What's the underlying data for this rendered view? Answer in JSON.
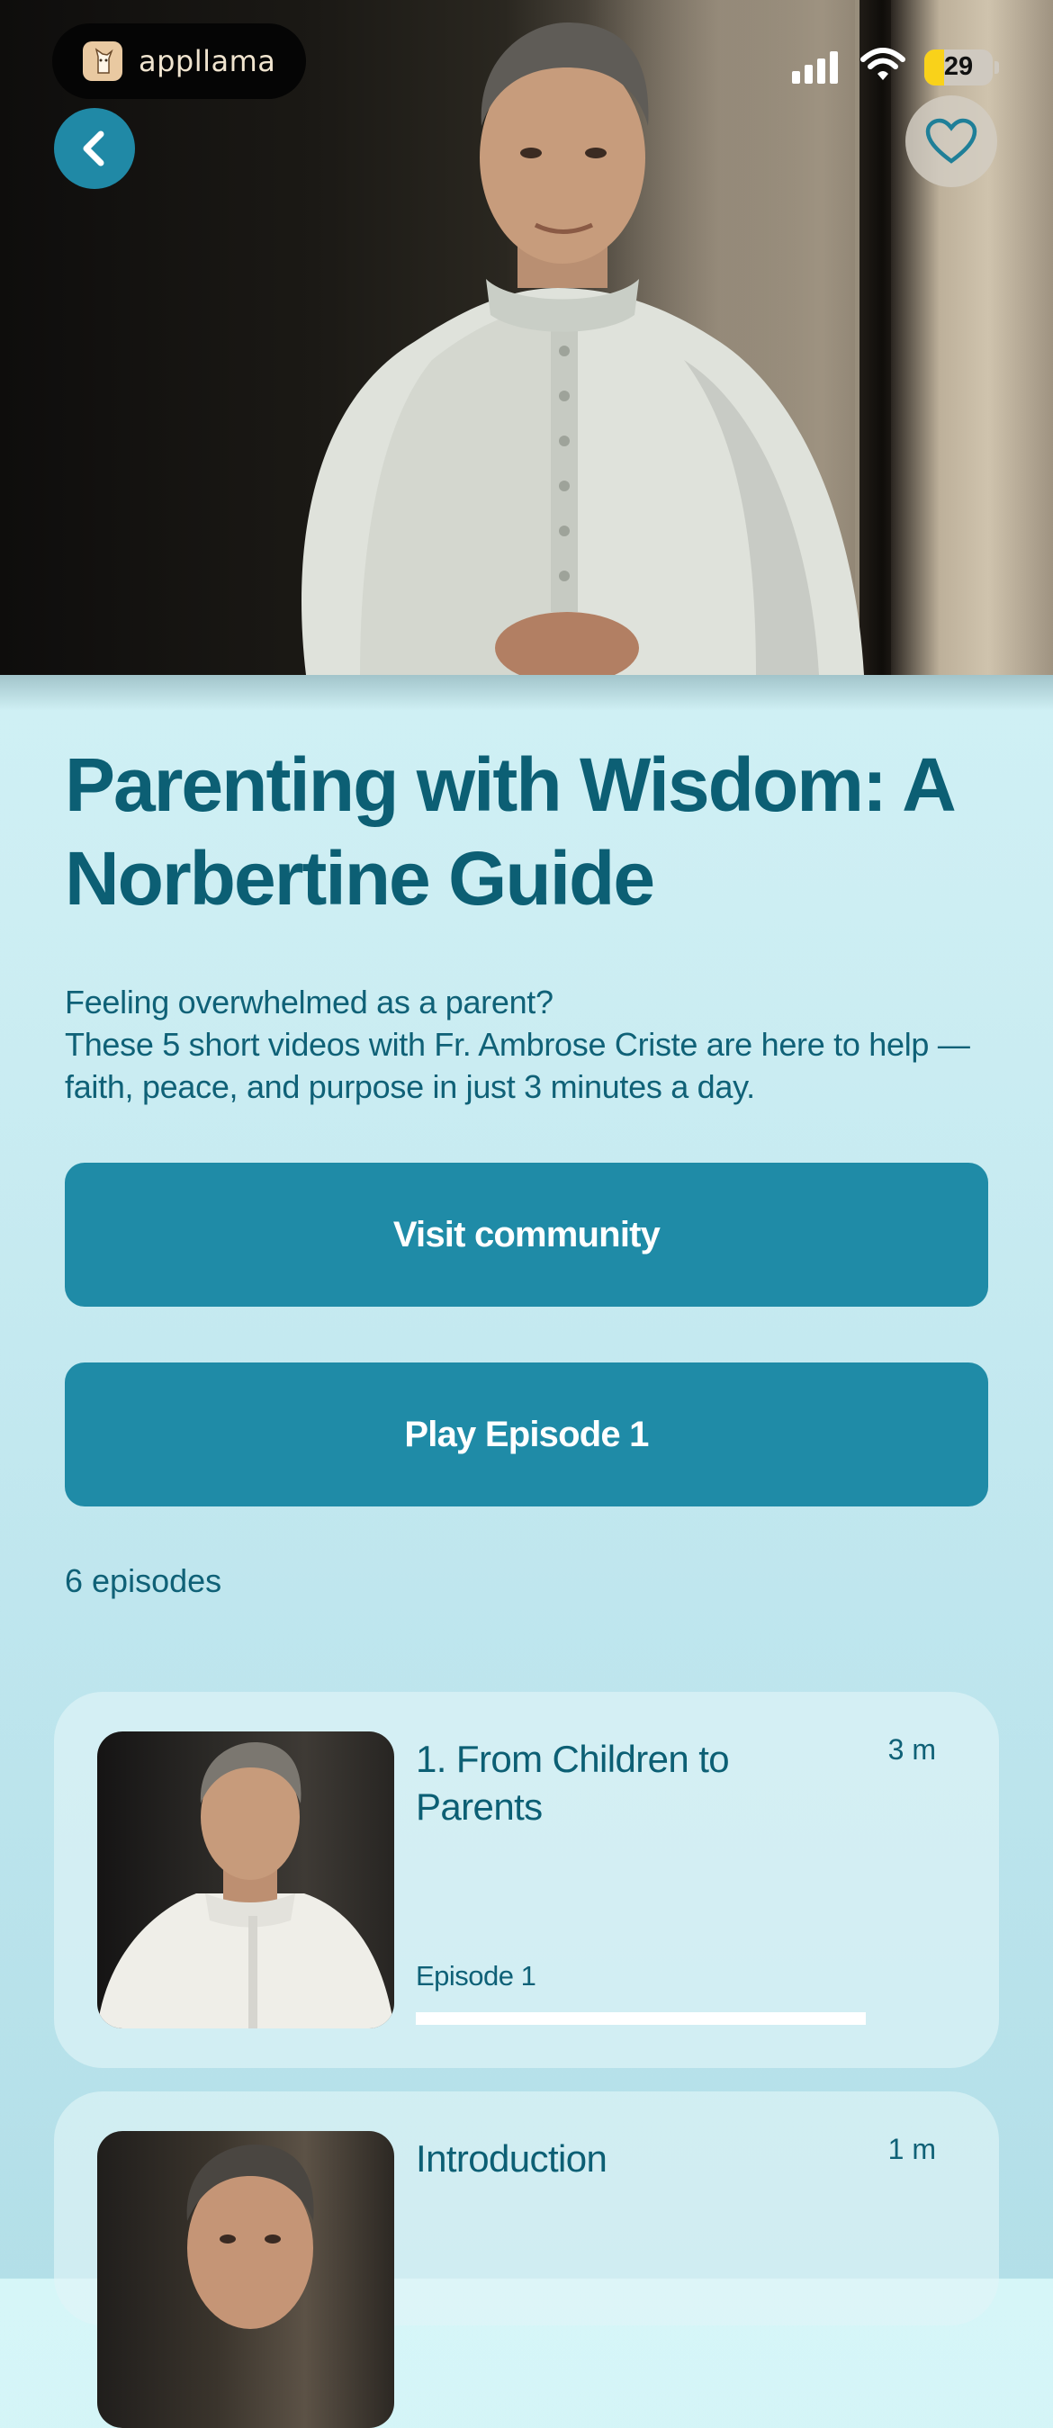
{
  "status_bar": {
    "brand_name": "appllama",
    "battery_level": "29",
    "battery_fraction": 0.29,
    "signal_bars": 4
  },
  "header": {
    "back_icon": "chevron-left-icon",
    "favorite_icon": "heart-outline-icon"
  },
  "course": {
    "title": "Parenting with Wisdom: A Norbertine Guide",
    "description_lines": [
      "Feeling overwhelmed as a parent?",
      "These 5 short videos with Fr. Ambrose Criste are here to help — faith, peace, and purpose in just 3 minutes a day."
    ],
    "visit_community_label": "Visit community",
    "play_label": "Play Episode 1",
    "episode_count": "6 episodes"
  },
  "episodes": [
    {
      "title": "1. From Children to Parents",
      "duration": "3 m",
      "label": "Episode 1",
      "progress": 1.0
    },
    {
      "title": "Introduction",
      "duration": "1 m"
    }
  ],
  "colors": {
    "accent": "#1f8ba7",
    "text": "#0c5f74",
    "background_top": "#d6f6f8",
    "background_bottom": "#b3dfe8",
    "battery": "#f9d21a"
  }
}
